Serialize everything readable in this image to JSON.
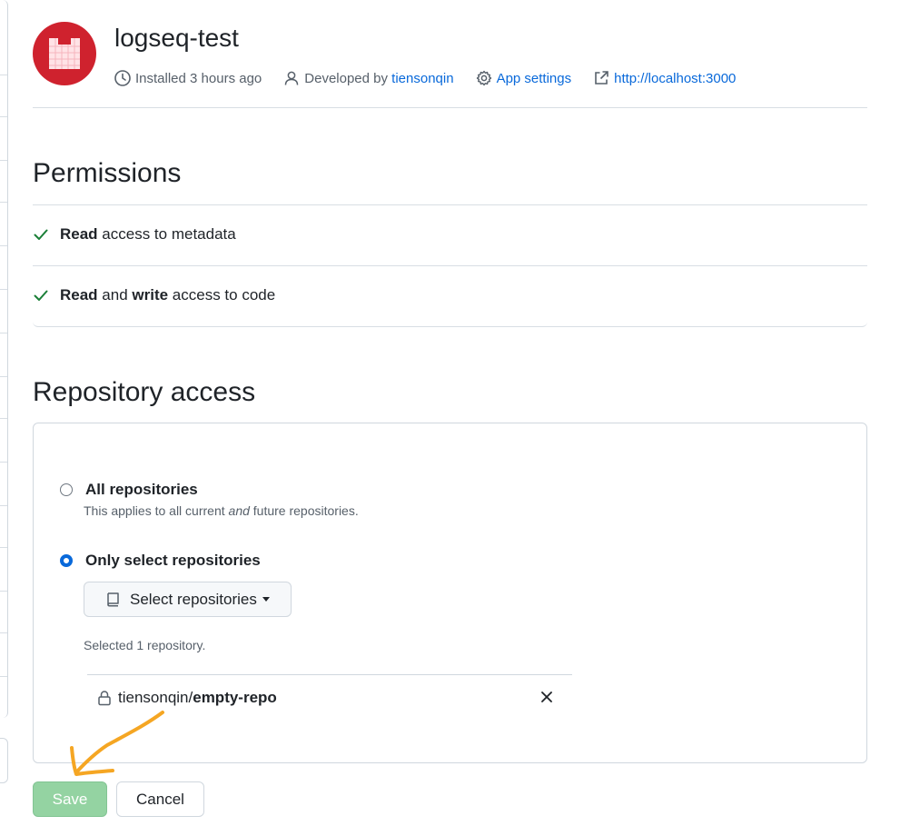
{
  "app": {
    "name": "logseq-test",
    "installed": "Installed 3 hours ago",
    "developed_prefix": "Developed by",
    "developer": "tiensonqin",
    "settings_label": "App settings",
    "homepage": "http://localhost:3000",
    "avatar_color": "#cf222e"
  },
  "permissions": {
    "title": "Permissions",
    "items": [
      {
        "parts": [
          {
            "text": "Read",
            "bold": true
          },
          {
            "text": " access to metadata",
            "bold": false
          }
        ]
      },
      {
        "parts": [
          {
            "text": "Read",
            "bold": true
          },
          {
            "text": " and ",
            "bold": false
          },
          {
            "text": "write",
            "bold": true
          },
          {
            "text": " access to code",
            "bold": false
          }
        ]
      }
    ]
  },
  "repository_access": {
    "title": "Repository access",
    "all": {
      "label": "All repositories",
      "note_before": "This applies to all current ",
      "note_em": "and",
      "note_after": " future repositories.",
      "checked": false
    },
    "select": {
      "label": "Only select repositories",
      "checked": true,
      "button_label": "Select repositories",
      "selected_count_text": "Selected 1 repository.",
      "repos": [
        {
          "owner": "tiensonqin/",
          "name": "empty-repo"
        }
      ]
    }
  },
  "actions": {
    "save_label": "Save",
    "cancel_label": "Cancel"
  },
  "colors": {
    "check": "#1a7f37",
    "link": "#0969da",
    "save_bg": "#94d3a2",
    "annotation": "#f5a623"
  }
}
